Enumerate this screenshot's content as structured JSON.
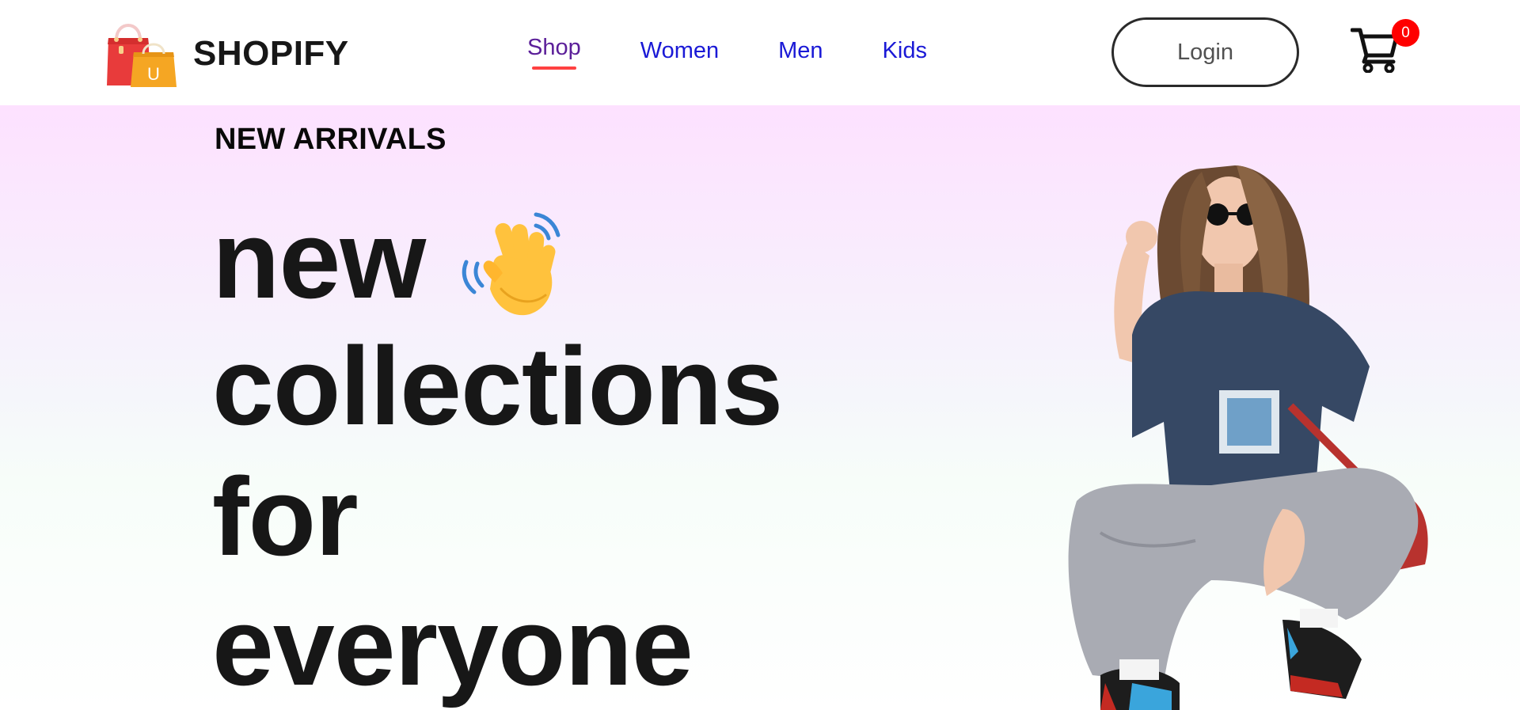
{
  "header": {
    "brand": "SHOPIFY",
    "logo_icon": "shopping-bag-icon",
    "logo_letter": "U",
    "nav": {
      "shop": "Shop",
      "women": "Women",
      "men": "Men",
      "kids": "Kids"
    },
    "active_nav": "Shop",
    "login_label": "Login",
    "cart_icon": "cart-icon",
    "cart_count": "0"
  },
  "hero": {
    "eyebrow": "NEW ARRIVALS",
    "headline": {
      "line1": "new",
      "line2": "collections",
      "line3": "for",
      "line4": "everyone"
    },
    "hand_icon": "waving-hand-icon"
  },
  "colors": {
    "nav_active": "#5b1f99",
    "nav_link": "#1a19d6",
    "nav_underline": "#ff4141",
    "cart_badge": "#ff0000",
    "hero_gradient_top": "#fde1ff",
    "hero_gradient_bottom": "#ffffff",
    "headline": "#171717"
  }
}
